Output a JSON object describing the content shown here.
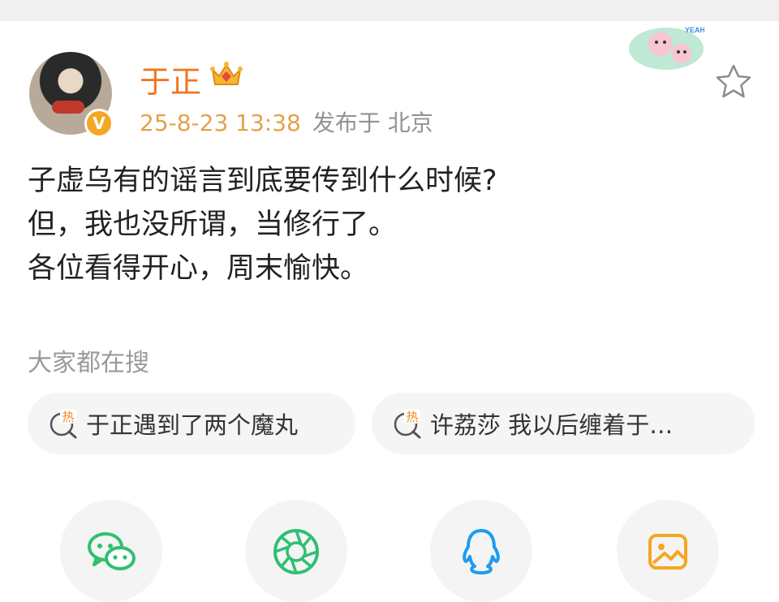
{
  "post": {
    "author": "于正",
    "timestamp": "25-8-23 13:38",
    "source": "发布于 北京",
    "lines": [
      "子虚乌有的谣言到底要传到什么时候?",
      "但，我也没所谓，当修行了。",
      "各位看得开心，周末愉快。"
    ]
  },
  "sticker": {
    "text": "YEAH!"
  },
  "hot_search": {
    "title": "大家都在搜",
    "items": [
      {
        "label": "于正遇到了两个魔丸",
        "badge": "热"
      },
      {
        "label": "许荔莎 我以后缠着于…",
        "badge": "热"
      }
    ]
  },
  "share": {
    "icons": [
      "wechat-icon",
      "moments-icon",
      "qq-icon",
      "qzone-icon"
    ]
  },
  "colors": {
    "author": "#f0751f",
    "timestamp": "#e3a24b",
    "verified_badge": "#f5a623",
    "hot_badge": "#f08a24"
  }
}
